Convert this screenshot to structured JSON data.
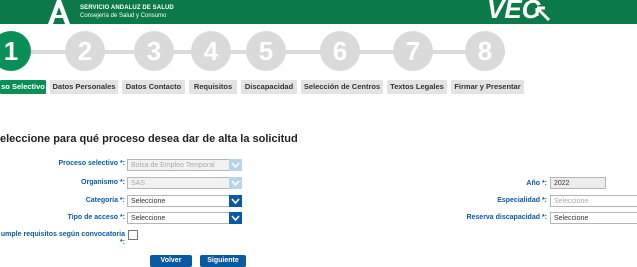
{
  "header": {
    "org_line1": "SERVICIO ANDALUZ DE SALUD",
    "org_line2": "Consejería de Salud y Consumo",
    "brand": "VEC",
    "logo_icon": "andalucia-logo-icon",
    "brand_color": "#0b7a48"
  },
  "steps": {
    "items": [
      "1",
      "2",
      "3",
      "4",
      "5",
      "6",
      "7",
      "8"
    ],
    "active": 1,
    "active_color": "#0a8f58",
    "inactive_color": "#dadada"
  },
  "tabs": {
    "items": [
      {
        "label": "so Selectivo",
        "active": true
      },
      {
        "label": "Datos Personales",
        "active": false
      },
      {
        "label": "Datos Contacto",
        "active": false
      },
      {
        "label": "Requisitos",
        "active": false
      },
      {
        "label": "Discapacidad",
        "active": false
      },
      {
        "label": "Selección de Centros",
        "active": false
      },
      {
        "label": "Textos Legales",
        "active": false
      },
      {
        "label": "Firmar y Presentar",
        "active": false
      }
    ]
  },
  "form": {
    "title": "eleccione para qué proceso desea dar de alta la solicitud",
    "proceso_label": "Proceso selectivo *:",
    "proceso_value": "Bolsa de Empleo Temporal",
    "organismo_label": "Organismo *:",
    "organismo_value": "SAS",
    "categoria_label": "Categoría *:",
    "categoria_value": "Seleccione",
    "tipo_label": "Tipo de acceso *:",
    "tipo_value": "Seleccione",
    "cumple_label_1": "umple requisitos según convocatoria",
    "cumple_label_2": "*:",
    "anio_label": "Año *:",
    "anio_value": "2022",
    "especialidad_label": "Especialidad *:",
    "especialidad_placeholder": "Seleccione",
    "reserva_label": "Reserva discapacidad *:",
    "reserva_value": "Seleccione"
  },
  "buttons": {
    "back_label": "Volver",
    "next_label": "Siguiente"
  }
}
